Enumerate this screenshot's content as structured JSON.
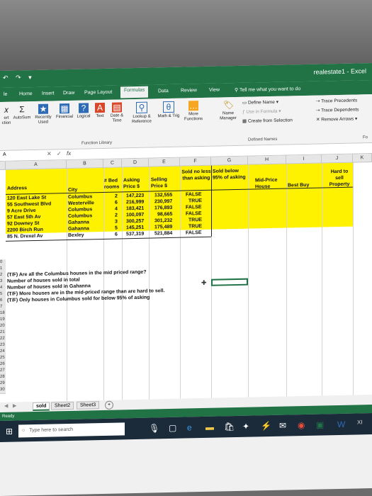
{
  "window": {
    "title": "realestate1 - Excel",
    "qat": "↶ ↷ ▾"
  },
  "tabs": [
    "le",
    "Home",
    "Insert",
    "Draw",
    "Page Layout",
    "Formulas",
    "Data",
    "Review",
    "View"
  ],
  "active_tab": "Formulas",
  "tell_me": "Tell me what you want to do",
  "ribbon": {
    "insert_function": "ert ction",
    "autosum": "AutoSum",
    "recently_used": "Recently Used",
    "financial": "Financial",
    "logical": "Logical",
    "text": "Text",
    "date_time": "Date & Time",
    "lookup_reference": "Lookup & Reference",
    "math_trig": "Math & Trig",
    "more_functions": "More Functions",
    "function_library": "Function Library",
    "name_manager": "Name Manager",
    "define_name": "Define Name",
    "use_in_formula": "Use in Formula",
    "create_from_selection": "Create from Selection",
    "defined_names": "Defined Names",
    "trace_precedents": "Trace Precedents",
    "trace_dependents": "Trace Dependents",
    "remove_arrows": "Remove Arrows",
    "fo": "Fo"
  },
  "formula_bar": {
    "name_box": "A",
    "fx": "fx"
  },
  "columns": [
    "A",
    "B",
    "C",
    "D",
    "E",
    "F",
    "G",
    "H",
    "I",
    "J",
    "K"
  ],
  "headers": {
    "address": "Address",
    "city": "City",
    "bed_rooms": "# Bed rooms",
    "asking_price": "Asking Price $",
    "selling_price": "Selling Price $",
    "sold_no_less": "Sold no less than asking",
    "sold_below": "Sold below 95% of asking",
    "mid_price": "Mid-Price House",
    "best_buy": "Best Buy",
    "hard_to_sell": "Hard to sell Property"
  },
  "rows": [
    {
      "address": "120 East Lake St",
      "city": "Columbus",
      "beds": "2",
      "asking": "147,223",
      "selling": "132,555",
      "sold": "FALSE"
    },
    {
      "address": "55 Southwest Blvd",
      "city": "Westerville",
      "beds": "6",
      "asking": "216,999",
      "selling": "230,997",
      "sold": "TRUE"
    },
    {
      "address": "9 Acre Drive",
      "city": "Columbus",
      "beds": "4",
      "asking": "183,421",
      "selling": "176,893",
      "sold": "FALSE"
    },
    {
      "address": "57 East 5th Av",
      "city": "Columbus",
      "beds": "2",
      "asking": "100,097",
      "selling": "98,665",
      "sold": "FALSE"
    },
    {
      "address": "92 Downey St",
      "city": "Gahanna",
      "beds": "3",
      "asking": "300,257",
      "selling": "301,232",
      "sold": "TRUE"
    },
    {
      "address": "2200 Birch Run",
      "city": "Gahanna",
      "beds": "5",
      "asking": "145,251",
      "selling": "175,489",
      "sold": "TRUE"
    },
    {
      "address": "85 N. Drexel Av",
      "city": "Bexley",
      "beds": "6",
      "asking": "537,319",
      "selling": "521,884",
      "sold": "FALSE"
    }
  ],
  "questions": [
    "(T/F) Are all the Columbus houses in the mid priced range?",
    "Number of houses sold in total",
    "Number of houses sold in Gahanna",
    "(T/F) More houses are in the mid-priced range than are hard to sell.",
    "(T/F) Only houses in Columbus sold for below  95% of asking"
  ],
  "row_numbers": [
    "0",
    "1",
    "2",
    "3",
    "4",
    "5",
    "6",
    "7",
    "18",
    "19",
    "20",
    "21",
    "22",
    "23",
    "24",
    "25",
    "26",
    "27",
    "28",
    "29",
    "30"
  ],
  "sheets": [
    "sold",
    "Sheet2",
    "Sheet3"
  ],
  "add_sheet": "+",
  "status": "Ready",
  "taskbar": {
    "search_placeholder": "Type here to search",
    "xbox": "XI"
  }
}
